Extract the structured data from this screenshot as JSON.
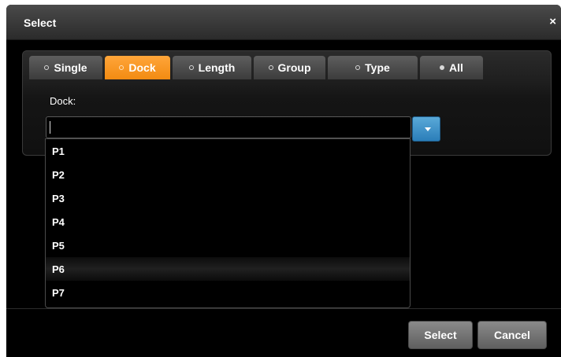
{
  "dialog": {
    "title": "Select",
    "close_label": "×"
  },
  "tabs": [
    {
      "label": "Single",
      "active": false
    },
    {
      "label": "Dock",
      "active": true
    },
    {
      "label": "Length",
      "active": false
    },
    {
      "label": "Group",
      "active": false
    },
    {
      "label": "Type",
      "active": false
    },
    {
      "label": "All",
      "active": false
    }
  ],
  "form": {
    "field_label": "Dock:",
    "input_value": ""
  },
  "dropdown": {
    "options": [
      "P1",
      "P2",
      "P3",
      "P4",
      "P5",
      "P6",
      "P7"
    ],
    "hovered": "P6"
  },
  "footer": {
    "select_label": "Select",
    "cancel_label": "Cancel"
  },
  "colors": {
    "active_tab": "#f28b12",
    "dropdown_button": "#2b7eb9",
    "background": "#000000"
  },
  "icons": {
    "close": "close-icon",
    "dropdown": "chevron-down-icon",
    "radio": "radio-dot-icon"
  }
}
